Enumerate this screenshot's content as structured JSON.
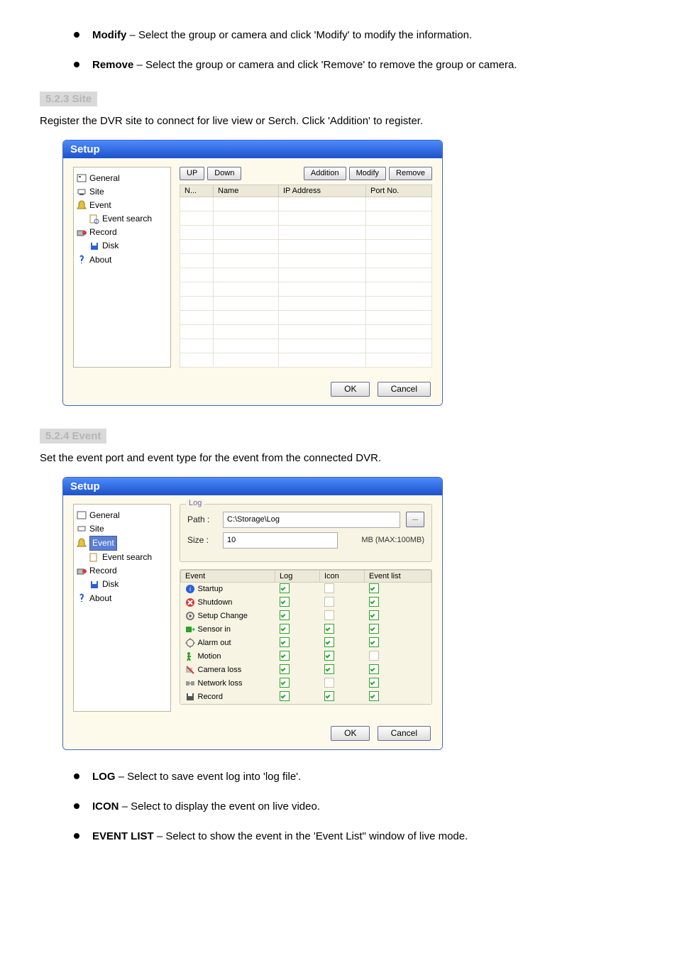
{
  "intro_bullets": [
    {
      "bold": "Modify",
      "text": " – Select the group or camera and click 'Modify' to modify the information."
    },
    {
      "bold": "Remove",
      "text": " – Select the group or camera and click 'Remove' to remove the group or camera."
    }
  ],
  "section_site": {
    "heading": "5.2.3  Site",
    "text": "Register the DVR site to connect for live view or Serch. Click 'Addition' to register."
  },
  "section_event": {
    "heading": "5.2.4  Event",
    "text": "Set the event port and event type for the event from the connected DVR."
  },
  "event_bullets": [
    {
      "bold": "LOG",
      "text": " – Select to save event log into 'log file'."
    },
    {
      "bold": "ICON",
      "text": " – Select to display the event on live video."
    },
    {
      "bold": "EVENT LIST",
      "text": " – Select to show the event in the 'Event List\" window of live mode."
    }
  ],
  "dialog": {
    "title": "Setup",
    "tree": [
      {
        "label": "General",
        "icon": "general"
      },
      {
        "label": "Site",
        "icon": "site"
      },
      {
        "label": "Event",
        "icon": "event",
        "children": [
          {
            "label": "Event search",
            "icon": "eventsearch"
          }
        ]
      },
      {
        "label": "Record",
        "icon": "record",
        "children": [
          {
            "label": "Disk",
            "icon": "disk"
          }
        ]
      },
      {
        "label": "About",
        "icon": "about"
      }
    ],
    "buttons": {
      "up": "UP",
      "down": "Down",
      "addition": "Addition",
      "modify": "Modify",
      "remove": "Remove",
      "ok": "OK",
      "cancel": "Cancel"
    },
    "site_table": {
      "headers": [
        "N...",
        "Name",
        "IP Address",
        "Port No."
      ]
    }
  },
  "dialog2": {
    "log": {
      "legend": "Log",
      "path_label": "Path :",
      "path_value": "C:\\Storage\\Log",
      "browse": "...",
      "size_label": "Size :",
      "size_value": "10",
      "size_hint": "MB  (MAX:100MB)"
    },
    "evt_headers": [
      "Event",
      "Log",
      "Icon",
      "Event list"
    ],
    "events": [
      {
        "name": "Startup",
        "icon": "startup",
        "log": true,
        "iconc": false,
        "list": true
      },
      {
        "name": "Shutdown",
        "icon": "shutdown",
        "log": true,
        "iconc": false,
        "list": true
      },
      {
        "name": "Setup Change",
        "icon": "setupchange",
        "log": true,
        "iconc": false,
        "list": true
      },
      {
        "name": "Sensor in",
        "icon": "sensorin",
        "log": true,
        "iconc": true,
        "list": true
      },
      {
        "name": "Alarm out",
        "icon": "alarmout",
        "log": true,
        "iconc": true,
        "list": true
      },
      {
        "name": "Motion",
        "icon": "motion",
        "log": true,
        "iconc": true,
        "list": false
      },
      {
        "name": "Camera loss",
        "icon": "cameraloss",
        "log": true,
        "iconc": true,
        "list": true
      },
      {
        "name": "Network loss",
        "icon": "networkloss",
        "log": true,
        "iconc": false,
        "list": true
      },
      {
        "name": "Record",
        "icon": "recorde",
        "log": true,
        "iconc": true,
        "list": true
      }
    ]
  }
}
